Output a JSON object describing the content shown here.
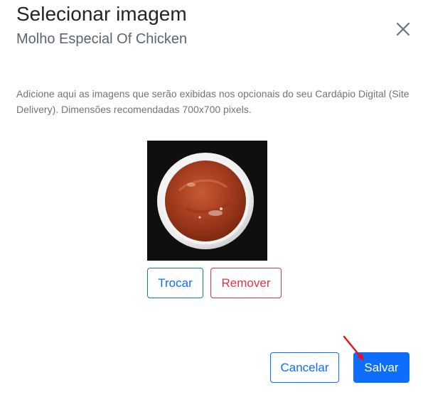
{
  "dialog": {
    "title": "Selecionar imagem",
    "subtitle": "Molho Especial Of Chicken",
    "close_icon": "close-icon",
    "description": "Adicione aqui as imagens que serão exibidas nos opcionais do seu Cardápio Digital (Site Delivery). Dimensões recomendadas 700x700 pixels."
  },
  "image": {
    "subject": "sauce-cup-photo"
  },
  "image_actions": {
    "swap_label": "Trocar",
    "remove_label": "Remover"
  },
  "footer": {
    "cancel_label": "Cancelar",
    "save_label": "Salvar"
  },
  "colors": {
    "primary": "#0d6efd",
    "danger": "#dc3545",
    "annotation_arrow": "#e8101a"
  }
}
